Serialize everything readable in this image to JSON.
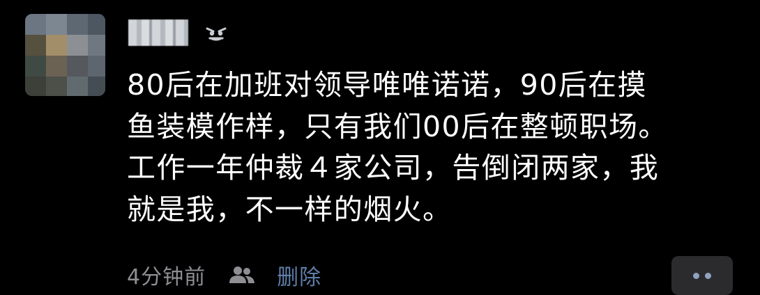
{
  "post": {
    "author_avatar_icon": "pixelated-avatar",
    "author_name_icon": "blurred-username",
    "emoji_icon": "angry-face-emoji",
    "text_lines": [
      "80后在加班对领导唯唯诺诺，90后在摸",
      "鱼装模作样，只有我们00后在整顿职场。",
      "工作一年仲裁４家公司，告倒闭两家，我",
      "就是我，不一样的烟火。"
    ],
    "time": "4分钟前",
    "visibility_icon": "friends-icon",
    "delete_label": "删除",
    "more_icon": "more-dots-icon"
  },
  "colors": {
    "background": "#000000",
    "text": "#ffffff",
    "muted": "#8e8e93",
    "link": "#5f7ea8",
    "button_bg": "#2b2b2e",
    "dots": "#8fa3c0"
  }
}
